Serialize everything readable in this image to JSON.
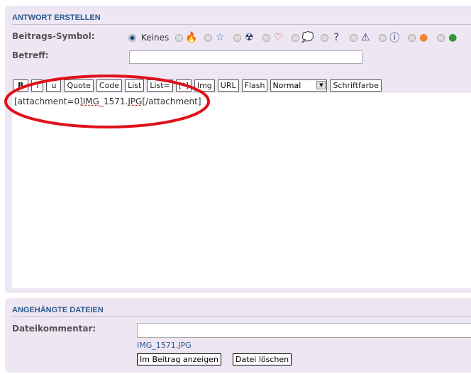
{
  "reply": {
    "title": "ANTWORT ERSTELLEN",
    "symbol_label": "Beitrags-Symbol:",
    "symbol_none": "Keines",
    "icons": [
      {
        "name": "fire-icon",
        "glyph": "🔥",
        "color": "#e44"
      },
      {
        "name": "star-icon",
        "glyph": "☆",
        "color": "#27c"
      },
      {
        "name": "radioactive-icon",
        "glyph": "☢",
        "color": "#236"
      },
      {
        "name": "heart-icon",
        "glyph": "♡",
        "color": "#c33"
      },
      {
        "name": "speech-bubble-icon",
        "glyph": "💭",
        "color": "#39c"
      },
      {
        "name": "question-icon",
        "glyph": "?",
        "color": "#236"
      },
      {
        "name": "warning-icon",
        "glyph": "⚠",
        "color": "#236"
      },
      {
        "name": "info-icon",
        "glyph": "ⓘ",
        "color": "#236"
      },
      {
        "name": "smiley-orange-icon",
        "glyph": "●",
        "color": "#e83"
      },
      {
        "name": "smiley-green-icon",
        "glyph": "●",
        "color": "#393"
      }
    ],
    "subject_label": "Betreff:",
    "subject_value": "",
    "toolbar": [
      "B",
      "i",
      "u",
      "Quote",
      "Code",
      "List",
      "List=",
      "[*]",
      "Img",
      "URL",
      "Flash"
    ],
    "font_size": "Normal",
    "font_color": "Schriftfarbe",
    "text_pre": "[attachment=0]",
    "text_file1": "IMG",
    "text_mid": "_1571.",
    "text_file2": "JPG",
    "text_post": "[/attachment]",
    "annotation_color": "#e0101a"
  },
  "attachments": {
    "title": "ANGEHÄNGTE DATEIEN",
    "comment_label": "Dateikommentar:",
    "comment_value": "",
    "filename": "IMG_1571.JPG",
    "show_button": "Im Beitrag anzeigen",
    "delete_button": "Datei löschen"
  }
}
